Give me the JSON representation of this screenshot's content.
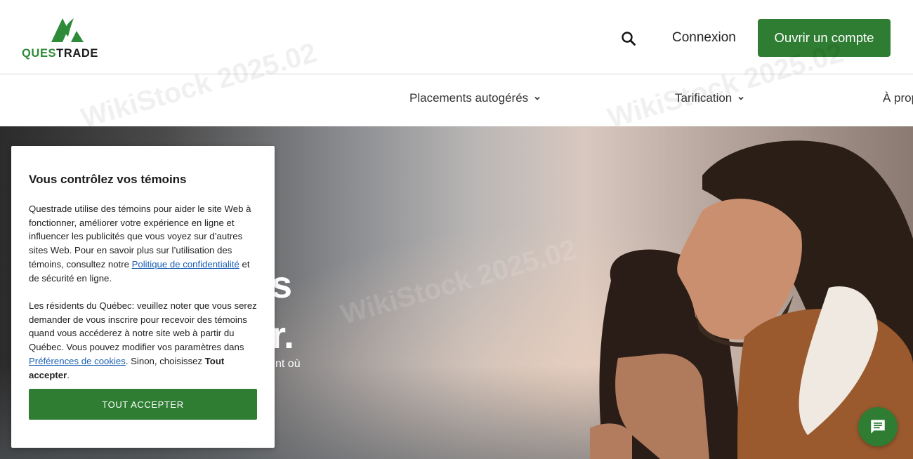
{
  "header": {
    "logo_text_primary": "QUES",
    "logo_text_secondary": "TRADE",
    "login_label": "Connexion",
    "open_account_label": "Ouvrir un compte",
    "search_icon": "search-icon"
  },
  "nav": {
    "items": [
      {
        "label": "Placements autogérés"
      },
      {
        "label": "Tarification"
      },
      {
        "label": "À propos"
      }
    ]
  },
  "watermark": {
    "text": "WikiStock 2025.02"
  },
  "hero": {
    "title_line1": "s",
    "title_line2": "r.",
    "subtitle_fragment": "nt où"
  },
  "cookie": {
    "title": "Vous contrôlez vos témoins",
    "p1_before": "Questrade utilise des témoins pour aider le site Web à fonctionner, améliorer votre expérience en ligne et influencer les publicités que vous voyez sur d’autres sites Web. Pour en savoir plus sur l’utilisation des témoins, consultez notre ",
    "p1_link": "Politique de confidentialité",
    "p1_after": " et de sécurité en ligne.",
    "p2_before": "Les résidents du Québec: veuillez noter que vous serez demander de vous inscrire pour recevoir des témoins quand vous accéderez à notre site web à partir du Québec. Vous pouvez modifier vos paramètres dans ",
    "p2_link": "Préférences de cookies",
    "p2_middle": ". Sinon, choisissez ",
    "p2_bold": "Tout accepter",
    "p2_end": ".",
    "accept_label": "TOUT ACCEPTER"
  },
  "chat": {
    "icon": "chat-icon"
  },
  "colors": {
    "brand_green": "#2e7d32",
    "link_blue": "#1a5fb4"
  }
}
